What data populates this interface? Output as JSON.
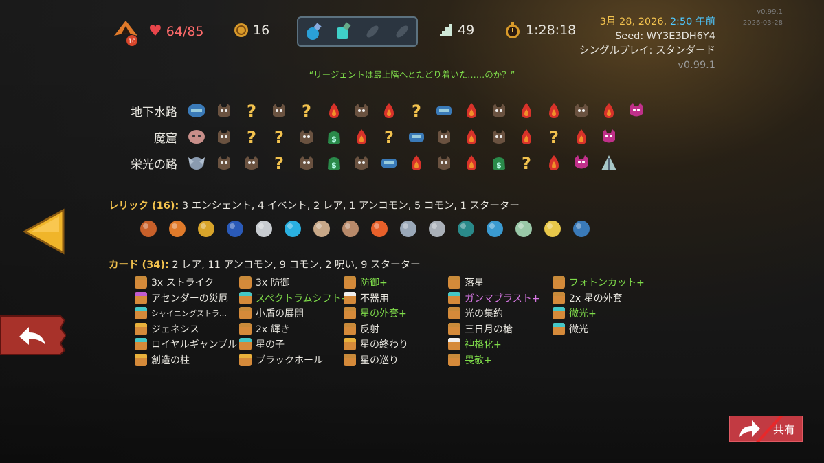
{
  "hud": {
    "ascension": "10",
    "hp": "64/85",
    "gold": "16",
    "floor": "49",
    "timer": "1:28:18"
  },
  "potions": [
    "blue-potion-icon",
    "cyan-potion-icon",
    "empty-potion-slot-icon",
    "empty-potion-slot-icon"
  ],
  "info": {
    "date": "3月 28, 2026,",
    "time": "2:50 午前",
    "seed": "Seed: WY3E3DH6Y4",
    "mode": "シングルプレイ: スタンダード",
    "version": "v0.99.1",
    "ghost_version": "v0.99.1",
    "ghost_date": "2026-03-28"
  },
  "quote": "“リージェントは最上階へとたどり着いた……のか？”",
  "acts": [
    {
      "name": "地下水路",
      "nodes": [
        "monster",
        "unknown",
        "monster",
        "unknown",
        "elite",
        "monster",
        "elite",
        "unknown",
        "shop",
        "elite",
        "monster",
        "elite",
        "elite",
        "monster",
        "elite",
        "boss"
      ]
    },
    {
      "name": "魔窟",
      "nodes": [
        "monster",
        "unknown",
        "unknown",
        "monster",
        "treasure",
        "elite",
        "unknown",
        "shop",
        "monster",
        "elite",
        "monster",
        "elite",
        "unknown",
        "elite",
        "boss"
      ]
    },
    {
      "name": "栄光の路",
      "nodes": [
        "monster",
        "monster",
        "unknown",
        "monster",
        "treasure",
        "monster",
        "shop",
        "elite",
        "monster",
        "elite",
        "treasure",
        "unknown",
        "elite",
        "boss",
        "boss2"
      ]
    }
  ],
  "relics": {
    "label": "レリック (16):",
    "summary": "3 エンシェント, 4 イベント, 2 レア, 1 アンコモン, 5 コモン, 1 スターター",
    "icons": [
      "campfire-rock-icon",
      "orange-horn-icon",
      "crown-icon",
      "blue-lotus-icon",
      "stone-icon",
      "blue-flame-icon",
      "teacup-icon",
      "snail-icon",
      "firework-icon",
      "compass-icon",
      "chandelier-icon",
      "chest-icon",
      "anchor-icon",
      "teapot-icon",
      "flower-pot-icon",
      "anchor-icon"
    ]
  },
  "cards": {
    "label": "カード (34):",
    "summary": "2 レア, 11 アンコモン, 9 コモン, 2 呪い, 9 スターター",
    "items": [
      {
        "text": "3x ストライク",
        "kind": "normal",
        "color": "#c88a3a"
      },
      {
        "text": "アセンダーの災厄",
        "kind": "normal",
        "color": "#c05bd0"
      },
      {
        "text": "シャイニングストラ…",
        "kind": "small",
        "color": "#44c7c7"
      },
      {
        "text": "ジェネシス",
        "kind": "normal",
        "color": "#e8b13c"
      },
      {
        "text": "ロイヤルギャンブル",
        "kind": "normal",
        "color": "#44c7c7"
      },
      {
        "text": "創造の柱",
        "kind": "normal",
        "color": "#e8b13c"
      },
      {
        "text": "3x 防御",
        "kind": "normal",
        "color": "#c88a3a"
      },
      {
        "text": "スペクトラムシフト+",
        "kind": "up",
        "color": "#44c7c7"
      },
      {
        "text": "小盾の展開",
        "kind": "normal",
        "color": "#c88a3a"
      },
      {
        "text": "2x 輝き",
        "kind": "normal",
        "color": "#c88a3a"
      },
      {
        "text": "星の子",
        "kind": "normal",
        "color": "#44c7c7"
      },
      {
        "text": "ブラックホール",
        "kind": "normal",
        "color": "#e8b13c"
      },
      {
        "text": "防御+",
        "kind": "up",
        "color": "#c88a3a"
      },
      {
        "text": "不器用",
        "kind": "normal",
        "color": "#f0f0f0"
      },
      {
        "text": "星の外套+",
        "kind": "up",
        "color": "#c88a3a"
      },
      {
        "text": "反射",
        "kind": "normal",
        "color": "#c88a3a"
      },
      {
        "text": "星の終わり",
        "kind": "normal",
        "color": "#e8b13c"
      },
      {
        "text": "星の巡り",
        "kind": "normal",
        "color": "#c88a3a"
      },
      {
        "text": "落星",
        "kind": "normal",
        "color": "#c88a3a"
      },
      {
        "text": "ガンマブラスト+",
        "kind": "cur",
        "color": "#44c7c7"
      },
      {
        "text": "光の集約",
        "kind": "normal",
        "color": "#c88a3a"
      },
      {
        "text": "三日月の槍",
        "kind": "normal",
        "color": "#c88a3a"
      },
      {
        "text": "神格化+",
        "kind": "up",
        "color": "#f0f0f0"
      },
      {
        "text": "畏敬+",
        "kind": "up",
        "color": "#c88a3a"
      },
      {
        "text": "フォトンカット+",
        "kind": "up",
        "color": "#c88a3a"
      },
      {
        "text": "2x 星の外套",
        "kind": "normal",
        "color": "#c88a3a"
      },
      {
        "text": "微光+",
        "kind": "up",
        "color": "#44c7c7"
      },
      {
        "text": "微光",
        "kind": "normal",
        "color": "#44c7c7"
      }
    ]
  },
  "buttons": {
    "share": "共有"
  }
}
